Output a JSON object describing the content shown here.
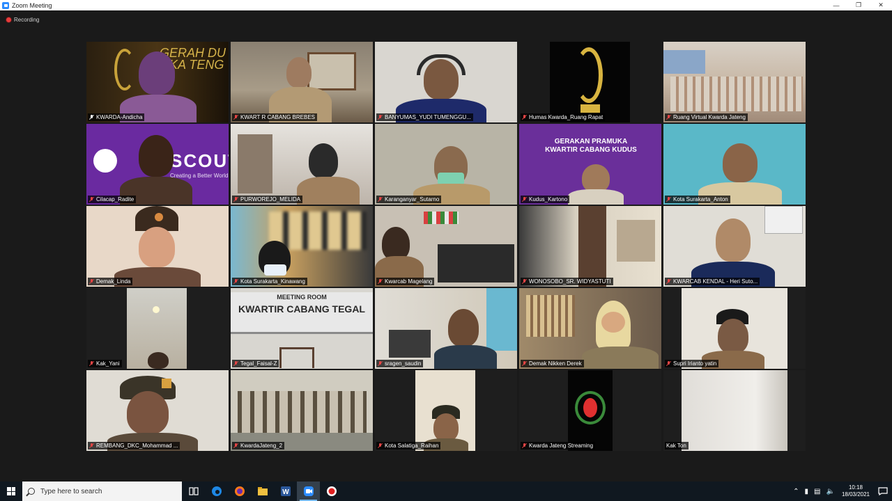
{
  "window": {
    "title": "Zoom Meeting"
  },
  "recording": {
    "label": "Recording"
  },
  "participants": [
    "KWARDA-Andicha",
    "KWART R CABANG BREBES",
    "BANYUMAS_YUDI TUMENGGU...",
    "Humas Kwarda_Ruang Rapat",
    "Ruang Virtual Kwarda Jateng",
    "Cilacap_Radite",
    "PURWOREJO_MELIDA",
    "Karanganyar_Sutarno",
    "Kudus_Kartono",
    "Kota Surakarta_Anton",
    "Demak_Linda",
    "Kota Surakarta_Kinawang",
    "Kwarcab Magelang",
    "WONOSOBO_SR. WIDYASTUTI",
    "KWARCAB KENDAL - Heri Suto...",
    "Kak_Yani",
    "Tegal_Faisal-Z",
    "sragen_saudin",
    "Demak Nikken Derek",
    "Supri Irianto yatin",
    "REMBANG_DKC_Mohammad ...",
    "KwardaJateng_2",
    "Kota Salatiga_Raihan",
    "Kwarda Jateng Streaming",
    "Kak Ton"
  ],
  "tile_text": {
    "scouts_logo": "SCOUTS",
    "scouts_tagline": "Creating a Better World",
    "kudus_banner_line1": "GERAKAN PRAMUKA",
    "kudus_banner_line2": "KWARTIR CABANG KUDUS",
    "tegal_sign_line1": "MEETING ROOM",
    "tegal_sign_line2": "KWARTIR CABANG TEGAL",
    "andicha_bg": "GERAH DU OKA TENG"
  },
  "taskbar": {
    "search_placeholder": "Type here to search",
    "time": "10:18",
    "date": "18/03/2021"
  },
  "colors": {
    "active_speaker": "#f5e23a",
    "muted_mic": "#e64545",
    "zoom_blue": "#2d8cff"
  }
}
